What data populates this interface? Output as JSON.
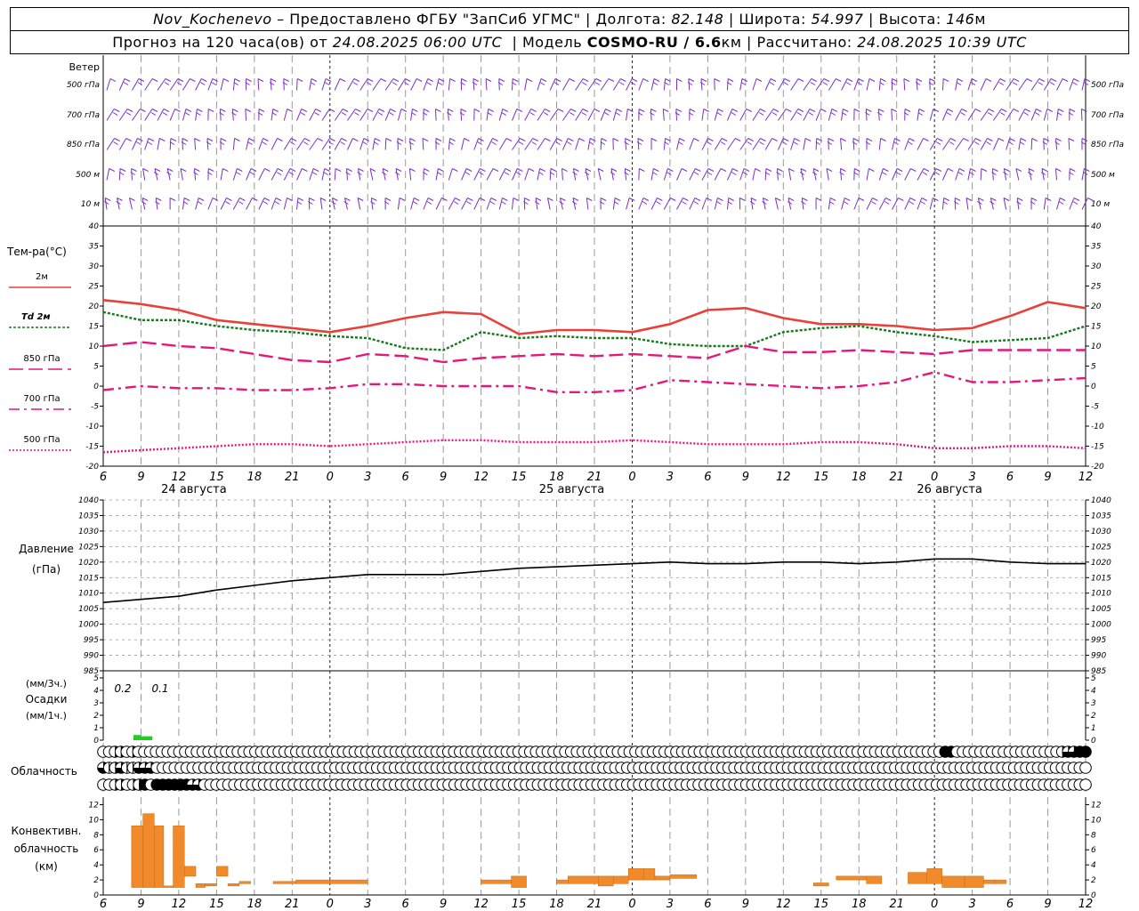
{
  "header": {
    "station": "Nov_Kochenevo",
    "provided": " – Предоставлено ФГБУ \"ЗапСиб УГМС\" ",
    "lon_label": "| Долгота: ",
    "lon": "82.148",
    "lat_label": " | Широта: ",
    "lat": "54.997",
    "alt_label": " | Высота: ",
    "alt": "146",
    "alt_unit": "м",
    "fc_label": "Прогноз на 120 часа(ов) от ",
    "fc_time": "24.08.2025 06:00 UTC",
    "model_label": "  | Модель ",
    "model": "COSMO-RU / 6.6",
    "model_unit": "км",
    "calc_label": " | Рассчитано: ",
    "calc_time": "24.08.2025 10:39 UTC"
  },
  "wind_panel": {
    "title": "Ветер",
    "levels": [
      "500 гПа",
      "700 гПа",
      "850 гПа",
      "500 м",
      "10 м"
    ],
    "barb_color": "#7b2fc8"
  },
  "time_axis": {
    "hour_labels": [
      "6",
      "9",
      "12",
      "15",
      "18",
      "21",
      "0",
      "3",
      "6",
      "9",
      "12",
      "15",
      "18",
      "21",
      "0",
      "3",
      "6",
      "9",
      "12",
      "15",
      "18",
      "21",
      "0",
      "3",
      "6",
      "9",
      "12"
    ],
    "day_labels": [
      "24 августа",
      "25 августа",
      "26 августа"
    ],
    "day_label_index": [
      2,
      12,
      22
    ],
    "midnight_index": [
      6,
      14,
      22
    ]
  },
  "chart_data": [
    {
      "type": "line",
      "panel": "temperature",
      "ylabel": "Тем-ра(°С)",
      "ylim": [
        -20,
        40
      ],
      "y_ticks": [
        40,
        35,
        30,
        25,
        20,
        15,
        10,
        5,
        0,
        -5,
        -10,
        -15,
        -20
      ],
      "x": [
        0,
        1,
        2,
        3,
        4,
        5,
        6,
        7,
        8,
        9,
        10,
        11,
        12,
        13,
        14,
        15,
        16,
        17,
        18,
        19,
        20,
        21,
        22,
        23,
        24,
        25,
        26
      ],
      "series": [
        {
          "name": "2м",
          "color": "#e8413a",
          "dash": "solid",
          "values": [
            21.5,
            20.5,
            19,
            16.5,
            15.5,
            14.5,
            13.5,
            15,
            17,
            18.5,
            18,
            13,
            14,
            14,
            13.5,
            15.5,
            19,
            19.5,
            17,
            15.5,
            15.5,
            15,
            14,
            14.5,
            17.5,
            21,
            19.5
          ]
        },
        {
          "name": "Td 2м",
          "color": "#157a1c",
          "dash": "dotted",
          "values": [
            18.5,
            16.5,
            16.5,
            15,
            14,
            13.5,
            12.5,
            12,
            9.5,
            9,
            13.5,
            12,
            12.5,
            12,
            12,
            10.5,
            10,
            10,
            13.5,
            14.5,
            15,
            13.5,
            12.5,
            11,
            11.5,
            12,
            15
          ]
        },
        {
          "name": "850 гПа",
          "color": "#e6177c",
          "dash": "long-dash",
          "values": [
            10,
            11,
            10,
            9.5,
            8,
            6.5,
            6,
            8,
            7.5,
            6,
            7,
            7.5,
            8,
            7.5,
            8,
            7.5,
            7,
            10,
            8.5,
            8.5,
            9,
            8.5,
            8,
            9,
            9,
            9,
            9
          ]
        },
        {
          "name": "700 гПа",
          "color": "#e6177c",
          "dash": "dash-dot",
          "values": [
            -1,
            0,
            -0.5,
            -0.5,
            -1,
            -1,
            -0.5,
            0.5,
            0.5,
            0,
            0,
            0,
            -1.5,
            -1.5,
            -1,
            1.5,
            1,
            0.5,
            0,
            -0.5,
            0,
            1,
            3.5,
            1,
            1,
            1.5,
            2
          ]
        },
        {
          "name": "500 гПа",
          "color": "#e6177c",
          "dash": "fine-dot",
          "values": [
            -16.5,
            -16,
            -15.5,
            -15,
            -14.5,
            -14.5,
            -15,
            -14.5,
            -14,
            -13.5,
            -13.5,
            -14,
            -14,
            -14,
            -13.5,
            -14,
            -14.5,
            -14.5,
            -14.5,
            -14,
            -14,
            -14.5,
            -15.5,
            -15.5,
            -15,
            -15,
            -15.5
          ]
        }
      ]
    },
    {
      "type": "line",
      "panel": "pressure",
      "ylabel": "Давление",
      "yunit": "(гПа)",
      "ylim": [
        985,
        1040
      ],
      "y_ticks": [
        1040,
        1035,
        1030,
        1025,
        1020,
        1015,
        1010,
        1005,
        1000,
        995,
        990,
        985
      ],
      "x": [
        0,
        1,
        2,
        3,
        4,
        5,
        6,
        7,
        8,
        9,
        10,
        11,
        12,
        13,
        14,
        15,
        16,
        17,
        18,
        19,
        20,
        21,
        22,
        23,
        24,
        25,
        26
      ],
      "series": [
        {
          "name": "",
          "color": "#000000",
          "values": [
            1007,
            1008,
            1009,
            1011,
            1012.5,
            1014,
            1015,
            1016,
            1016,
            1016,
            1017,
            1018,
            1018.5,
            1019,
            1019.5,
            1020,
            1019.5,
            1019.5,
            1020,
            1020,
            1019.5,
            1020,
            1021,
            1021,
            1020,
            1019.5,
            1019.5
          ]
        }
      ]
    },
    {
      "type": "bar",
      "panel": "precipitation",
      "ylabel": "Осадки",
      "unit_3h": "(мм/3ч.)",
      "unit_1h": "(мм/1ч.)",
      "ylim": [
        0,
        5
      ],
      "y_ticks": [
        5,
        4,
        3,
        2,
        1,
        0
      ],
      "bars": [
        {
          "start": 0.8,
          "end": 1.0,
          "value": 0.2,
          "label": "0.2"
        },
        {
          "start": 1.0,
          "end": 1.3,
          "value": 0.1,
          "label": "0.1"
        }
      ],
      "color": "#22cc22"
    },
    {
      "type": "heatmap",
      "panel": "cloudiness",
      "ylabel": "Облачность",
      "layers": [
        "0022020000000000000000000000000000000000000000000000000000000000000000000000000000000000000000000000000000000000000000000000000000000000000000004400000000000000000023344",
        "3123113330000000000000000000000000000000000000000000000000000000000000000000000000000000000000000000000000000000000000000000000000000000000000000000000000000000000000",
        "0022022404444443300000000000000000000000000000000000000000000000000000000000000000000000000000000000000000000000000000000000000000000000000000000000000000000000000000"
      ]
    },
    {
      "type": "bar",
      "panel": "convective",
      "ylabel": "Конвективн.",
      "ylabel2": "облачность",
      "yunit": "(км)",
      "ylim": [
        0,
        13
      ],
      "y_ticks": [
        12,
        10,
        8,
        6,
        4,
        2,
        0
      ],
      "color": "#f08a2a",
      "segments": [
        {
          "x0": 0.75,
          "x1": 1.05,
          "bottom": 1.0,
          "top": 9.2
        },
        {
          "x0": 1.05,
          "x1": 1.35,
          "bottom": 1.0,
          "top": 10.8
        },
        {
          "x0": 1.35,
          "x1": 1.6,
          "bottom": 1.0,
          "top": 9.2
        },
        {
          "x0": 1.6,
          "x1": 1.85,
          "bottom": 1.0,
          "top": 1.2
        },
        {
          "x0": 1.85,
          "x1": 2.15,
          "bottom": 1.0,
          "top": 9.2
        },
        {
          "x0": 2.15,
          "x1": 2.45,
          "bottom": 2.5,
          "top": 3.8
        },
        {
          "x0": 2.45,
          "x1": 2.7,
          "bottom": 1.0,
          "top": 1.5
        },
        {
          "x0": 2.7,
          "x1": 3.0,
          "bottom": 1.2,
          "top": 1.5
        },
        {
          "x0": 3.0,
          "x1": 3.3,
          "bottom": 2.5,
          "top": 3.8
        },
        {
          "x0": 3.3,
          "x1": 3.6,
          "bottom": 1.2,
          "top": 1.5
        },
        {
          "x0": 3.6,
          "x1": 3.9,
          "bottom": 1.5,
          "top": 1.8
        },
        {
          "x0": 4.5,
          "x1": 5.1,
          "bottom": 1.5,
          "top": 1.8
        },
        {
          "x0": 5.1,
          "x1": 6.0,
          "bottom": 1.5,
          "top": 2.0
        },
        {
          "x0": 6.0,
          "x1": 7.0,
          "bottom": 1.5,
          "top": 2.0
        },
        {
          "x0": 10.0,
          "x1": 10.8,
          "bottom": 1.5,
          "top": 2.0
        },
        {
          "x0": 10.8,
          "x1": 11.2,
          "bottom": 1.0,
          "top": 2.5
        },
        {
          "x0": 12.0,
          "x1": 12.3,
          "bottom": 1.5,
          "top": 2.0
        },
        {
          "x0": 12.3,
          "x1": 13.1,
          "bottom": 1.5,
          "top": 2.5
        },
        {
          "x0": 13.1,
          "x1": 13.5,
          "bottom": 1.2,
          "top": 2.5
        },
        {
          "x0": 13.5,
          "x1": 13.9,
          "bottom": 1.5,
          "top": 2.5
        },
        {
          "x0": 13.9,
          "x1": 14.3,
          "bottom": 2.0,
          "top": 3.5
        },
        {
          "x0": 14.3,
          "x1": 14.6,
          "bottom": 2.0,
          "top": 3.5
        },
        {
          "x0": 14.6,
          "x1": 15.0,
          "bottom": 2.0,
          "top": 2.5
        },
        {
          "x0": 15.0,
          "x1": 15.7,
          "bottom": 2.2,
          "top": 2.7
        },
        {
          "x0": 18.8,
          "x1": 19.2,
          "bottom": 1.2,
          "top": 1.6
        },
        {
          "x0": 19.4,
          "x1": 20.2,
          "bottom": 2.0,
          "top": 2.5
        },
        {
          "x0": 20.2,
          "x1": 20.6,
          "bottom": 1.5,
          "top": 2.5
        },
        {
          "x0": 21.3,
          "x1": 21.8,
          "bottom": 1.5,
          "top": 3.0
        },
        {
          "x0": 21.8,
          "x1": 22.2,
          "bottom": 1.5,
          "top": 3.5
        },
        {
          "x0": 22.2,
          "x1": 22.8,
          "bottom": 1.0,
          "top": 2.5
        },
        {
          "x0": 22.8,
          "x1": 23.3,
          "bottom": 1.0,
          "top": 2.5
        },
        {
          "x0": 23.3,
          "x1": 23.6,
          "bottom": 1.5,
          "top": 2.0
        },
        {
          "x0": 23.6,
          "x1": 23.9,
          "bottom": 1.5,
          "top": 2.0
        }
      ]
    }
  ]
}
